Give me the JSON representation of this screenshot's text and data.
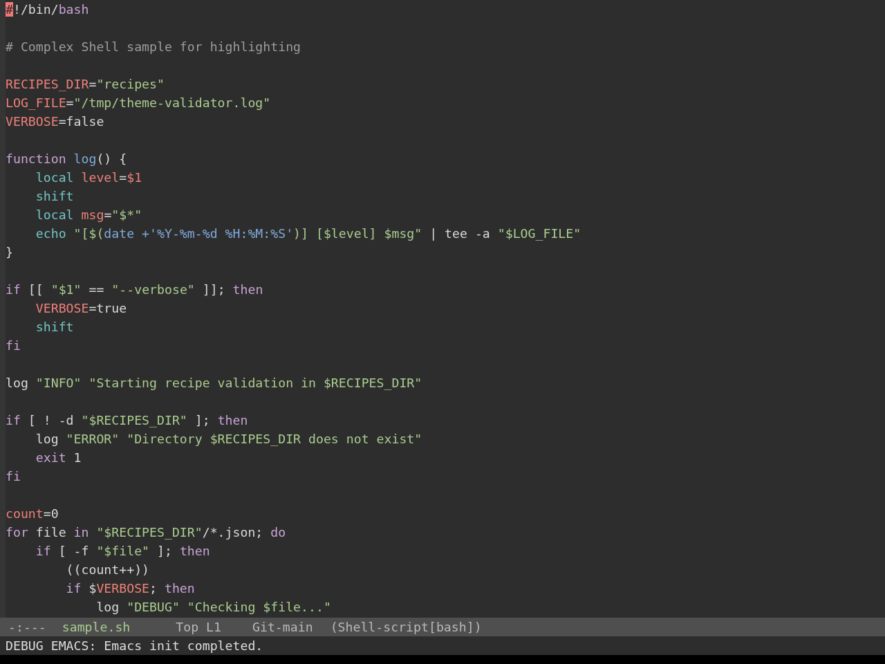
{
  "editor": {
    "blocks": [
      {
        "lines": [
          {
            "segments": [
              {
                "text": "#",
                "kind": "cursor"
              },
              {
                "text": "!/bin/",
                "kind": "plain"
              },
              {
                "text": "bash",
                "kind": "keyword"
              }
            ]
          }
        ]
      },
      {
        "lines": [
          {
            "segments": [
              {
                "text": "# Complex Shell sample for highlighting",
                "kind": "comment"
              }
            ]
          }
        ]
      },
      {
        "lines": [
          {
            "segments": [
              {
                "text": "RECIPES_DIR",
                "kind": "variable"
              },
              {
                "text": "=",
                "kind": "plain"
              },
              {
                "text": "\"recipes\"",
                "kind": "string"
              }
            ]
          },
          {
            "segments": [
              {
                "text": "LOG_FILE",
                "kind": "variable"
              },
              {
                "text": "=",
                "kind": "plain"
              },
              {
                "text": "\"/tmp/theme-validator.log\"",
                "kind": "string"
              }
            ]
          },
          {
            "segments": [
              {
                "text": "VERBOSE",
                "kind": "variable"
              },
              {
                "text": "=false",
                "kind": "plain"
              }
            ]
          }
        ]
      },
      {
        "lines": [
          {
            "segments": [
              {
                "text": "function",
                "kind": "keyword"
              },
              {
                "text": " log",
                "kind": "function"
              },
              {
                "text": "() {",
                "kind": "plain"
              }
            ]
          },
          {
            "segments": [
              {
                "text": "    local",
                "kind": "builtin"
              },
              {
                "text": " level",
                "kind": "variable"
              },
              {
                "text": "=",
                "kind": "plain"
              },
              {
                "text": "$1",
                "kind": "variable"
              }
            ]
          },
          {
            "segments": [
              {
                "text": "    shift",
                "kind": "builtin"
              }
            ]
          },
          {
            "segments": [
              {
                "text": "    local",
                "kind": "builtin"
              },
              {
                "text": " msg",
                "kind": "variable"
              },
              {
                "text": "=",
                "kind": "plain"
              },
              {
                "text": "\"$*\"",
                "kind": "string"
              }
            ]
          },
          {
            "segments": [
              {
                "text": "    echo",
                "kind": "builtin"
              },
              {
                "text": " \"[$(",
                "kind": "string"
              },
              {
                "text": "date +'%Y-%m-%d %H:%M:%S'",
                "kind": "function"
              },
              {
                "text": ")] [$level] $msg\"",
                "kind": "string"
              },
              {
                "text": " | tee -a ",
                "kind": "plain"
              },
              {
                "text": "\"$LOG_FILE\"",
                "kind": "string"
              }
            ]
          },
          {
            "segments": [
              {
                "text": "}",
                "kind": "plain"
              }
            ]
          }
        ]
      },
      {
        "lines": [
          {
            "segments": [
              {
                "text": "if",
                "kind": "keyword"
              },
              {
                "text": " [[ ",
                "kind": "plain"
              },
              {
                "text": "\"$1\"",
                "kind": "string"
              },
              {
                "text": " == ",
                "kind": "plain"
              },
              {
                "text": "\"--verbose\"",
                "kind": "string"
              },
              {
                "text": " ]]; ",
                "kind": "plain"
              },
              {
                "text": "then",
                "kind": "keyword"
              }
            ]
          },
          {
            "segments": [
              {
                "text": "    VERBOSE",
                "kind": "variable"
              },
              {
                "text": "=true",
                "kind": "plain"
              }
            ]
          },
          {
            "segments": [
              {
                "text": "    shift",
                "kind": "builtin"
              }
            ]
          },
          {
            "segments": [
              {
                "text": "fi",
                "kind": "keyword"
              }
            ]
          }
        ]
      },
      {
        "lines": [
          {
            "segments": [
              {
                "text": "log ",
                "kind": "plain"
              },
              {
                "text": "\"INFO\"",
                "kind": "string"
              },
              {
                "text": " \"Starting recipe validation in $RECIPES_DIR\"",
                "kind": "string"
              }
            ]
          }
        ]
      },
      {
        "lines": [
          {
            "segments": [
              {
                "text": "if",
                "kind": "keyword"
              },
              {
                "text": " [ ! -d ",
                "kind": "plain"
              },
              {
                "text": "\"$RECIPES_DIR\"",
                "kind": "string"
              },
              {
                "text": " ]; ",
                "kind": "plain"
              },
              {
                "text": "then",
                "kind": "keyword"
              }
            ]
          },
          {
            "segments": [
              {
                "text": "    log ",
                "kind": "plain"
              },
              {
                "text": "\"ERROR\"",
                "kind": "string"
              },
              {
                "text": " \"Directory $RECIPES_DIR does not exist\"",
                "kind": "string"
              }
            ]
          },
          {
            "segments": [
              {
                "text": "    exit",
                "kind": "keyword"
              },
              {
                "text": " 1",
                "kind": "plain"
              }
            ]
          },
          {
            "segments": [
              {
                "text": "fi",
                "kind": "keyword"
              }
            ]
          }
        ]
      },
      {
        "lines": [
          {
            "segments": [
              {
                "text": "count",
                "kind": "variable"
              },
              {
                "text": "=0",
                "kind": "plain"
              }
            ]
          },
          {
            "segments": [
              {
                "text": "for",
                "kind": "keyword"
              },
              {
                "text": " file ",
                "kind": "plain"
              },
              {
                "text": "in",
                "kind": "keyword"
              },
              {
                "text": " \"$RECIPES_DIR\"",
                "kind": "string"
              },
              {
                "text": "/*.json; ",
                "kind": "plain"
              },
              {
                "text": "do",
                "kind": "keyword"
              }
            ]
          },
          {
            "segments": [
              {
                "text": "    if",
                "kind": "keyword"
              },
              {
                "text": " [ -f ",
                "kind": "plain"
              },
              {
                "text": "\"$file\"",
                "kind": "string"
              },
              {
                "text": " ]; ",
                "kind": "plain"
              },
              {
                "text": "then",
                "kind": "keyword"
              }
            ]
          },
          {
            "segments": [
              {
                "text": "        ((count++))",
                "kind": "plain"
              }
            ]
          },
          {
            "segments": [
              {
                "text": "        if",
                "kind": "keyword"
              },
              {
                "text": " $",
                "kind": "plain"
              },
              {
                "text": "VERBOSE",
                "kind": "variable"
              },
              {
                "text": "; ",
                "kind": "plain"
              },
              {
                "text": "then",
                "kind": "keyword"
              }
            ]
          },
          {
            "segments": [
              {
                "text": "            log ",
                "kind": "plain"
              },
              {
                "text": "\"DEBUG\"",
                "kind": "string"
              },
              {
                "text": " \"Checking $file...\"",
                "kind": "string"
              }
            ]
          }
        ]
      }
    ]
  },
  "mode_line": {
    "status": "-:---",
    "buffer_name": "sample.sh",
    "position": "Top L1",
    "vc_branch": "Git-main",
    "major_mode": "(Shell-script[bash])"
  },
  "echo_area": {
    "message": "DEBUG EMACS: Emacs init completed."
  }
}
